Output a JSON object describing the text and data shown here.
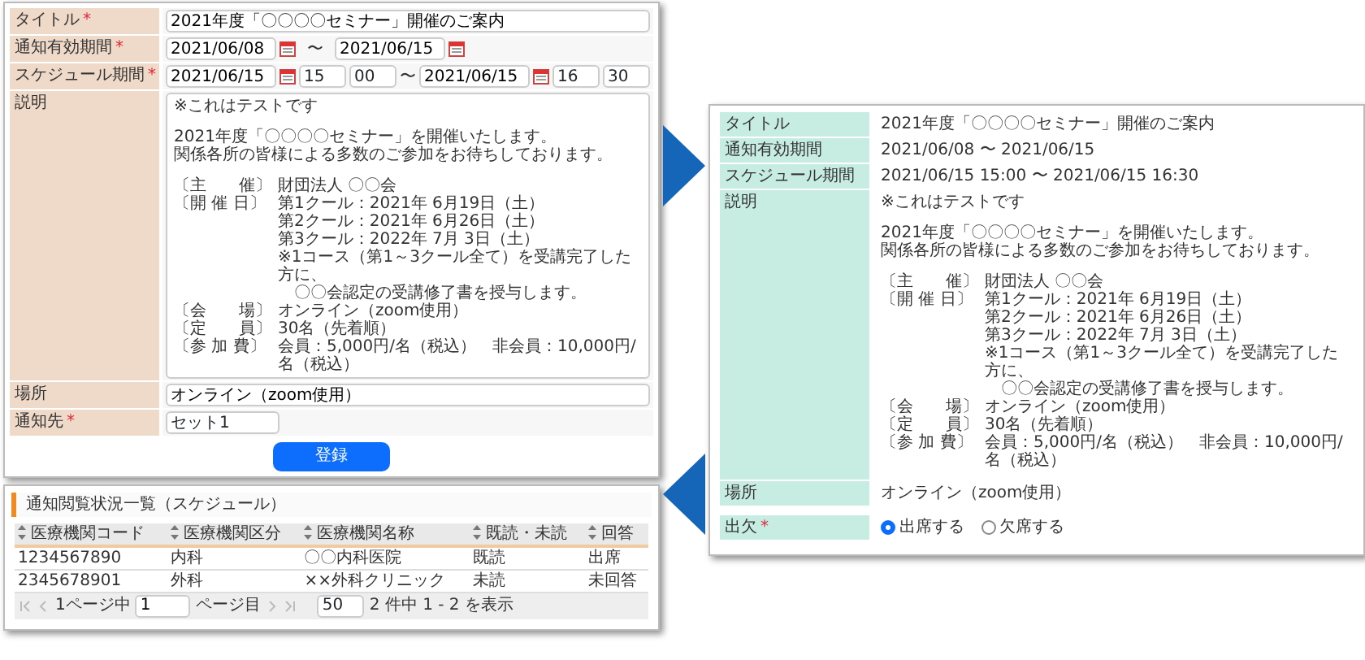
{
  "edit_form": {
    "fields": [
      {
        "kind": "text",
        "label": "タイトル",
        "required_mark": "*",
        "value": "2021年度「〇〇〇〇セミナー」開催のご案内"
      },
      {
        "kind": "daterange",
        "label": "通知有効期間",
        "required_mark": "*",
        "from": "2021/06/08",
        "separator": "〜",
        "to": "2021/06/15"
      },
      {
        "kind": "datetimerange",
        "label": "スケジュール期間",
        "required_mark": "*",
        "from": "2021/06/15",
        "from_hour": "15",
        "from_minute": "00",
        "separator": "〜",
        "to": "2021/06/15",
        "to_hour": "16",
        "to_minute": "30"
      },
      {
        "kind": "textarea",
        "label": "説明",
        "description": {
          "note": "※これはテストです",
          "intro": [
            "2021年度「〇〇〇〇セミナー」を開催いたします。",
            "関係各所の皆様による多数のご参加をお待ちしております。"
          ],
          "details": [
            {
              "label": "〔主　　催〕",
              "text": "財団法人 〇〇会"
            },
            {
              "label": "〔開 催 日〕",
              "text": "第1クール：2021年 6月19日（土）"
            },
            {
              "text": "第2クール：2021年 6月26日（土）"
            },
            {
              "text": "第3クール：2022年 7月 3日（土）"
            },
            {
              "text": "※1コース（第1～3クール全て）を受講完了した方に、"
            },
            {
              "text": "　〇〇会認定の受講修了書を授与します。"
            },
            {
              "label": "〔会　　場〕",
              "text": "オンライン（zoom使用）"
            },
            {
              "label": "〔定　　員〕",
              "text": "30名（先着順）"
            },
            {
              "label": "〔参 加 費〕",
              "text": "会員：5,000円/名（税込）　非会員：10,000円/名（税込）"
            }
          ]
        }
      },
      {
        "kind": "text",
        "label": "場所",
        "value": "オンライン（zoom使用）"
      },
      {
        "kind": "select",
        "label": "通知先",
        "required_mark": "*",
        "value": "セット1"
      }
    ],
    "submit": "登録"
  },
  "detail_view": {
    "rows": [
      {
        "kind": "text",
        "label": "タイトル",
        "value": "2021年度「〇〇〇〇セミナー」開催のご案内"
      },
      {
        "kind": "text",
        "label": "通知有効期間",
        "value": "2021/06/08 〜 2021/06/15"
      },
      {
        "kind": "text",
        "label": "スケジュール期間",
        "value": "2021/06/15 15:00 〜 2021/06/15 16:30"
      },
      {
        "kind": "description",
        "label": "説明",
        "description": {
          "note": "※これはテストです",
          "intro": [
            "2021年度「〇〇〇〇セミナー」を開催いたします。",
            "関係各所の皆様による多数のご参加をお待ちしております。"
          ],
          "details": [
            {
              "label": "〔主　　催〕",
              "text": "財団法人 〇〇会"
            },
            {
              "label": "〔開 催 日〕",
              "text": "第1クール：2021年 6月19日（土）"
            },
            {
              "text": "第2クール：2021年 6月26日（土）"
            },
            {
              "text": "第3クール：2022年 7月 3日（土）"
            },
            {
              "text": "※1コース（第1～3クール全て）を受講完了した方に、"
            },
            {
              "text": "　〇〇会認定の受講修了書を授与します。"
            },
            {
              "label": "〔会　　場〕",
              "text": "オンライン（zoom使用）"
            },
            {
              "label": "〔定　　員〕",
              "text": "30名（先着順）"
            },
            {
              "label": "〔参 加 費〕",
              "text": "会員：5,000円/名（税込）　非会員：10,000円/名（税込）"
            }
          ]
        }
      },
      {
        "kind": "text",
        "label": "場所",
        "value": "オンライン（zoom使用）"
      },
      {
        "kind": "radio",
        "label": "出欠",
        "required_mark": "*",
        "options": [
          {
            "label": "出席する",
            "selected": true
          },
          {
            "label": "欠席する",
            "selected": false
          }
        ]
      }
    ]
  },
  "status_table": {
    "title": "通知閲覧状況一覧（スケジュール）",
    "columns": [
      "医療機関コード",
      "医療機関区分",
      "医療機関名称",
      "既読・未読",
      "回答"
    ],
    "rows": [
      [
        "1234567890",
        "内科",
        "〇〇内科医院",
        "既読",
        "出席"
      ],
      [
        "2345678901",
        "外科",
        "××外科クリニック",
        "未読",
        "未回答"
      ]
    ],
    "pager": {
      "before": "1ページ中",
      "page": "1",
      "after": "ページ目",
      "page_size": "50",
      "summary": "2 件中 1 - 2 を表示"
    }
  }
}
